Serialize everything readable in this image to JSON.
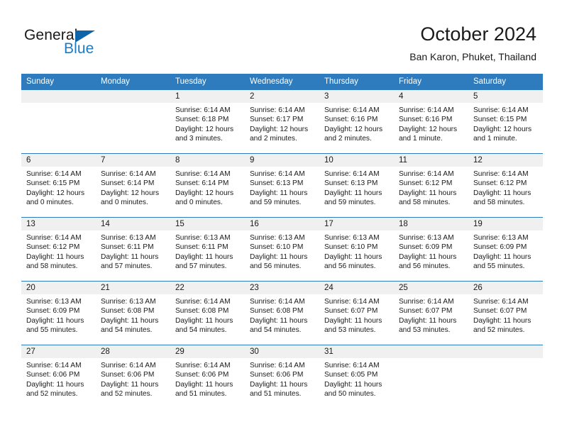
{
  "brand": {
    "name_part1": "General",
    "name_part2": "Blue",
    "triangle_color": "#1064a8",
    "blue_color": "#1f7ac1"
  },
  "header": {
    "title": "October 2024",
    "subtitle": "Ban Karon, Phuket, Thailand"
  },
  "theme": {
    "header_bg": "#2e7cbe",
    "daynum_bg": "#f0f0f0",
    "text": "#1a1a1a"
  },
  "weekday_headers": [
    "Sunday",
    "Monday",
    "Tuesday",
    "Wednesday",
    "Thursday",
    "Friday",
    "Saturday"
  ],
  "weeks": [
    [
      {
        "day": "",
        "sunrise": "",
        "sunset": "",
        "daylight1": "",
        "daylight2": ""
      },
      {
        "day": "",
        "sunrise": "",
        "sunset": "",
        "daylight1": "",
        "daylight2": ""
      },
      {
        "day": "1",
        "sunrise": "Sunrise: 6:14 AM",
        "sunset": "Sunset: 6:18 PM",
        "daylight1": "Daylight: 12 hours",
        "daylight2": "and 3 minutes."
      },
      {
        "day": "2",
        "sunrise": "Sunrise: 6:14 AM",
        "sunset": "Sunset: 6:17 PM",
        "daylight1": "Daylight: 12 hours",
        "daylight2": "and 2 minutes."
      },
      {
        "day": "3",
        "sunrise": "Sunrise: 6:14 AM",
        "sunset": "Sunset: 6:16 PM",
        "daylight1": "Daylight: 12 hours",
        "daylight2": "and 2 minutes."
      },
      {
        "day": "4",
        "sunrise": "Sunrise: 6:14 AM",
        "sunset": "Sunset: 6:16 PM",
        "daylight1": "Daylight: 12 hours",
        "daylight2": "and 1 minute."
      },
      {
        "day": "5",
        "sunrise": "Sunrise: 6:14 AM",
        "sunset": "Sunset: 6:15 PM",
        "daylight1": "Daylight: 12 hours",
        "daylight2": "and 1 minute."
      }
    ],
    [
      {
        "day": "6",
        "sunrise": "Sunrise: 6:14 AM",
        "sunset": "Sunset: 6:15 PM",
        "daylight1": "Daylight: 12 hours",
        "daylight2": "and 0 minutes."
      },
      {
        "day": "7",
        "sunrise": "Sunrise: 6:14 AM",
        "sunset": "Sunset: 6:14 PM",
        "daylight1": "Daylight: 12 hours",
        "daylight2": "and 0 minutes."
      },
      {
        "day": "8",
        "sunrise": "Sunrise: 6:14 AM",
        "sunset": "Sunset: 6:14 PM",
        "daylight1": "Daylight: 12 hours",
        "daylight2": "and 0 minutes."
      },
      {
        "day": "9",
        "sunrise": "Sunrise: 6:14 AM",
        "sunset": "Sunset: 6:13 PM",
        "daylight1": "Daylight: 11 hours",
        "daylight2": "and 59 minutes."
      },
      {
        "day": "10",
        "sunrise": "Sunrise: 6:14 AM",
        "sunset": "Sunset: 6:13 PM",
        "daylight1": "Daylight: 11 hours",
        "daylight2": "and 59 minutes."
      },
      {
        "day": "11",
        "sunrise": "Sunrise: 6:14 AM",
        "sunset": "Sunset: 6:12 PM",
        "daylight1": "Daylight: 11 hours",
        "daylight2": "and 58 minutes."
      },
      {
        "day": "12",
        "sunrise": "Sunrise: 6:14 AM",
        "sunset": "Sunset: 6:12 PM",
        "daylight1": "Daylight: 11 hours",
        "daylight2": "and 58 minutes."
      }
    ],
    [
      {
        "day": "13",
        "sunrise": "Sunrise: 6:14 AM",
        "sunset": "Sunset: 6:12 PM",
        "daylight1": "Daylight: 11 hours",
        "daylight2": "and 58 minutes."
      },
      {
        "day": "14",
        "sunrise": "Sunrise: 6:13 AM",
        "sunset": "Sunset: 6:11 PM",
        "daylight1": "Daylight: 11 hours",
        "daylight2": "and 57 minutes."
      },
      {
        "day": "15",
        "sunrise": "Sunrise: 6:13 AM",
        "sunset": "Sunset: 6:11 PM",
        "daylight1": "Daylight: 11 hours",
        "daylight2": "and 57 minutes."
      },
      {
        "day": "16",
        "sunrise": "Sunrise: 6:13 AM",
        "sunset": "Sunset: 6:10 PM",
        "daylight1": "Daylight: 11 hours",
        "daylight2": "and 56 minutes."
      },
      {
        "day": "17",
        "sunrise": "Sunrise: 6:13 AM",
        "sunset": "Sunset: 6:10 PM",
        "daylight1": "Daylight: 11 hours",
        "daylight2": "and 56 minutes."
      },
      {
        "day": "18",
        "sunrise": "Sunrise: 6:13 AM",
        "sunset": "Sunset: 6:09 PM",
        "daylight1": "Daylight: 11 hours",
        "daylight2": "and 56 minutes."
      },
      {
        "day": "19",
        "sunrise": "Sunrise: 6:13 AM",
        "sunset": "Sunset: 6:09 PM",
        "daylight1": "Daylight: 11 hours",
        "daylight2": "and 55 minutes."
      }
    ],
    [
      {
        "day": "20",
        "sunrise": "Sunrise: 6:13 AM",
        "sunset": "Sunset: 6:09 PM",
        "daylight1": "Daylight: 11 hours",
        "daylight2": "and 55 minutes."
      },
      {
        "day": "21",
        "sunrise": "Sunrise: 6:13 AM",
        "sunset": "Sunset: 6:08 PM",
        "daylight1": "Daylight: 11 hours",
        "daylight2": "and 54 minutes."
      },
      {
        "day": "22",
        "sunrise": "Sunrise: 6:14 AM",
        "sunset": "Sunset: 6:08 PM",
        "daylight1": "Daylight: 11 hours",
        "daylight2": "and 54 minutes."
      },
      {
        "day": "23",
        "sunrise": "Sunrise: 6:14 AM",
        "sunset": "Sunset: 6:08 PM",
        "daylight1": "Daylight: 11 hours",
        "daylight2": "and 54 minutes."
      },
      {
        "day": "24",
        "sunrise": "Sunrise: 6:14 AM",
        "sunset": "Sunset: 6:07 PM",
        "daylight1": "Daylight: 11 hours",
        "daylight2": "and 53 minutes."
      },
      {
        "day": "25",
        "sunrise": "Sunrise: 6:14 AM",
        "sunset": "Sunset: 6:07 PM",
        "daylight1": "Daylight: 11 hours",
        "daylight2": "and 53 minutes."
      },
      {
        "day": "26",
        "sunrise": "Sunrise: 6:14 AM",
        "sunset": "Sunset: 6:07 PM",
        "daylight1": "Daylight: 11 hours",
        "daylight2": "and 52 minutes."
      }
    ],
    [
      {
        "day": "27",
        "sunrise": "Sunrise: 6:14 AM",
        "sunset": "Sunset: 6:06 PM",
        "daylight1": "Daylight: 11 hours",
        "daylight2": "and 52 minutes."
      },
      {
        "day": "28",
        "sunrise": "Sunrise: 6:14 AM",
        "sunset": "Sunset: 6:06 PM",
        "daylight1": "Daylight: 11 hours",
        "daylight2": "and 52 minutes."
      },
      {
        "day": "29",
        "sunrise": "Sunrise: 6:14 AM",
        "sunset": "Sunset: 6:06 PM",
        "daylight1": "Daylight: 11 hours",
        "daylight2": "and 51 minutes."
      },
      {
        "day": "30",
        "sunrise": "Sunrise: 6:14 AM",
        "sunset": "Sunset: 6:06 PM",
        "daylight1": "Daylight: 11 hours",
        "daylight2": "and 51 minutes."
      },
      {
        "day": "31",
        "sunrise": "Sunrise: 6:14 AM",
        "sunset": "Sunset: 6:05 PM",
        "daylight1": "Daylight: 11 hours",
        "daylight2": "and 50 minutes."
      },
      {
        "day": "",
        "sunrise": "",
        "sunset": "",
        "daylight1": "",
        "daylight2": ""
      },
      {
        "day": "",
        "sunrise": "",
        "sunset": "",
        "daylight1": "",
        "daylight2": ""
      }
    ]
  ]
}
